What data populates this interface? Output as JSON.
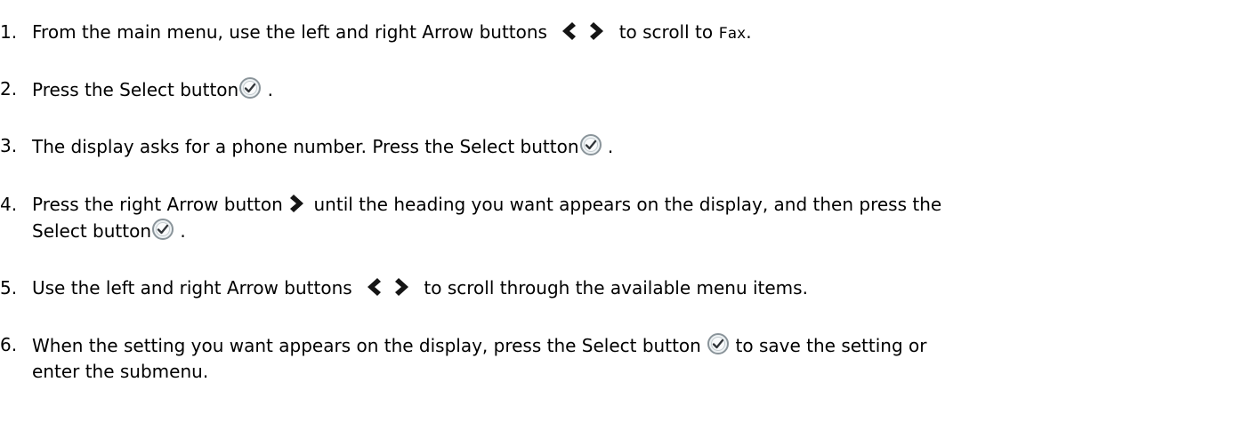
{
  "steps": [
    {
      "number": "1.",
      "text_1": "From the main menu, use the left and right Arrow buttons",
      "text_2": "to scroll to",
      "menu_item": "Fax",
      "text_3": ".",
      "icons": [
        "left-arrow-icon",
        "right-arrow-icon"
      ]
    },
    {
      "number": "2.",
      "text_1": "Press the Select button",
      "text_2": ".",
      "icons": [
        "select-check-icon"
      ]
    },
    {
      "number": "3.",
      "text_1": "The display asks for a phone number. Press the Select button",
      "text_2": ".",
      "icons": [
        "select-check-icon"
      ]
    },
    {
      "number": "4.",
      "text_1": "Press the right Arrow button",
      "text_2": "until the heading you want appears on the display, and then press the",
      "text_3": "Select button",
      "text_4": ".",
      "icons": [
        "right-arrow-icon",
        "select-check-icon"
      ]
    },
    {
      "number": "5.",
      "text_1": "Use the left and right Arrow buttons",
      "text_2": "to scroll through the available menu items.",
      "icons": [
        "left-arrow-icon",
        "right-arrow-icon"
      ]
    },
    {
      "number": "6.",
      "text_1": "When the setting you want appears on the display, press the Select button",
      "text_2": "to save the setting or",
      "text_3": "enter the submenu.",
      "icons": [
        "select-check-icon"
      ]
    }
  ]
}
